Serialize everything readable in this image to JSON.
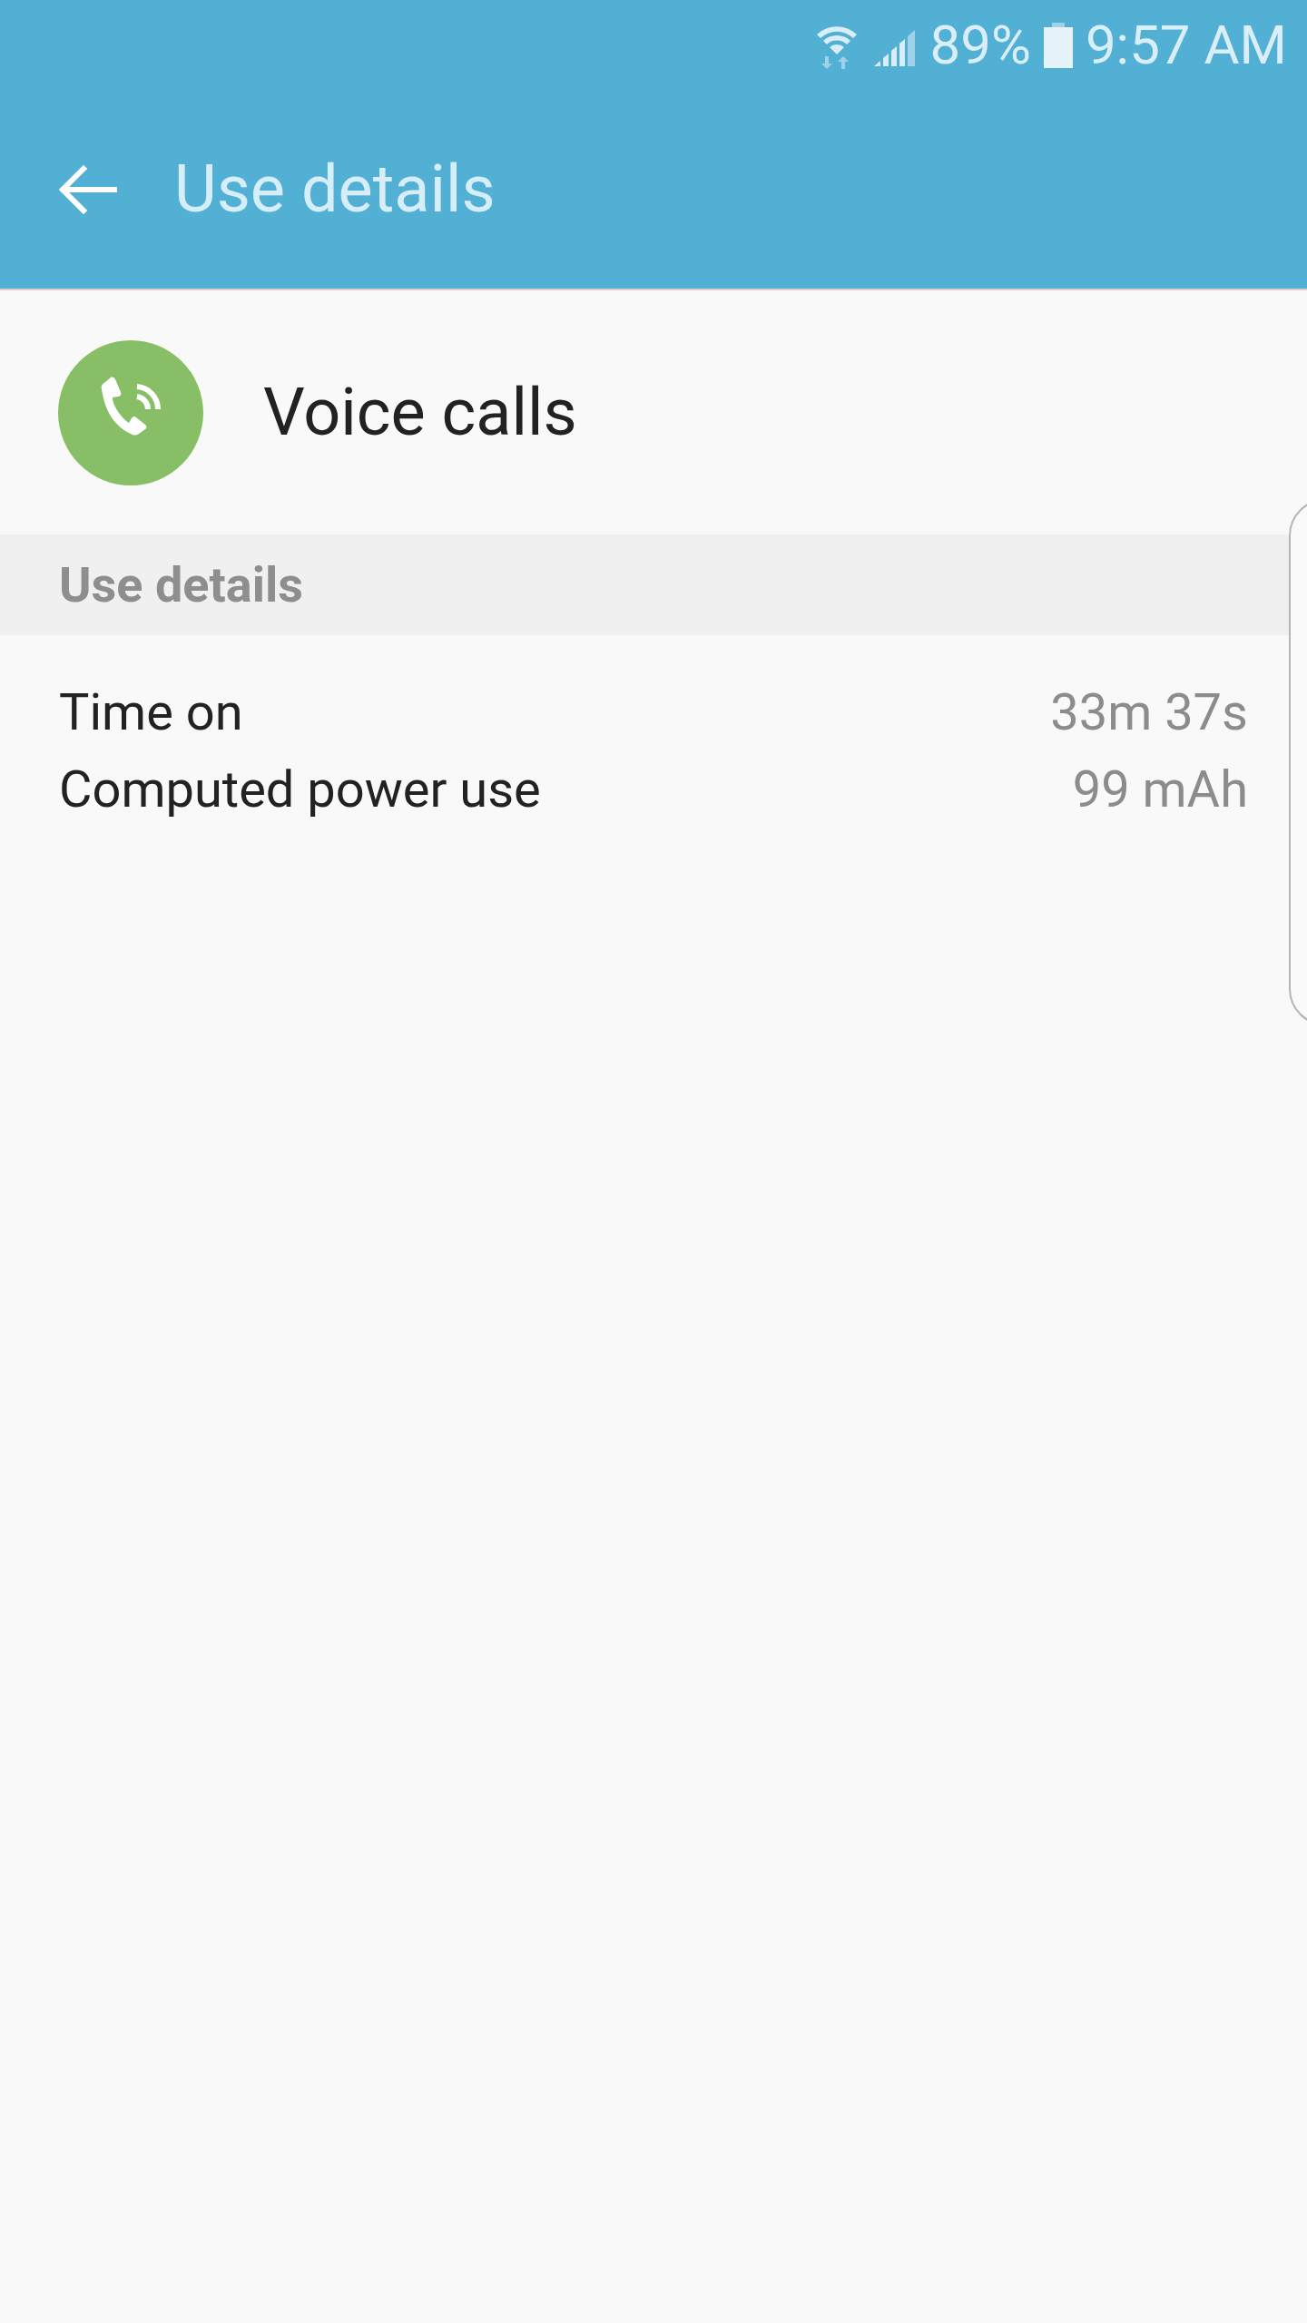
{
  "status_bar": {
    "battery": "89%",
    "time": "9:57 AM"
  },
  "app_bar": {
    "title": "Use details"
  },
  "app": {
    "name": "Voice calls"
  },
  "section": {
    "title": "Use details"
  },
  "rows": [
    {
      "label": "Time on",
      "value": "33m 37s"
    },
    {
      "label": "Computed power use",
      "value": "99 mAh"
    }
  ]
}
